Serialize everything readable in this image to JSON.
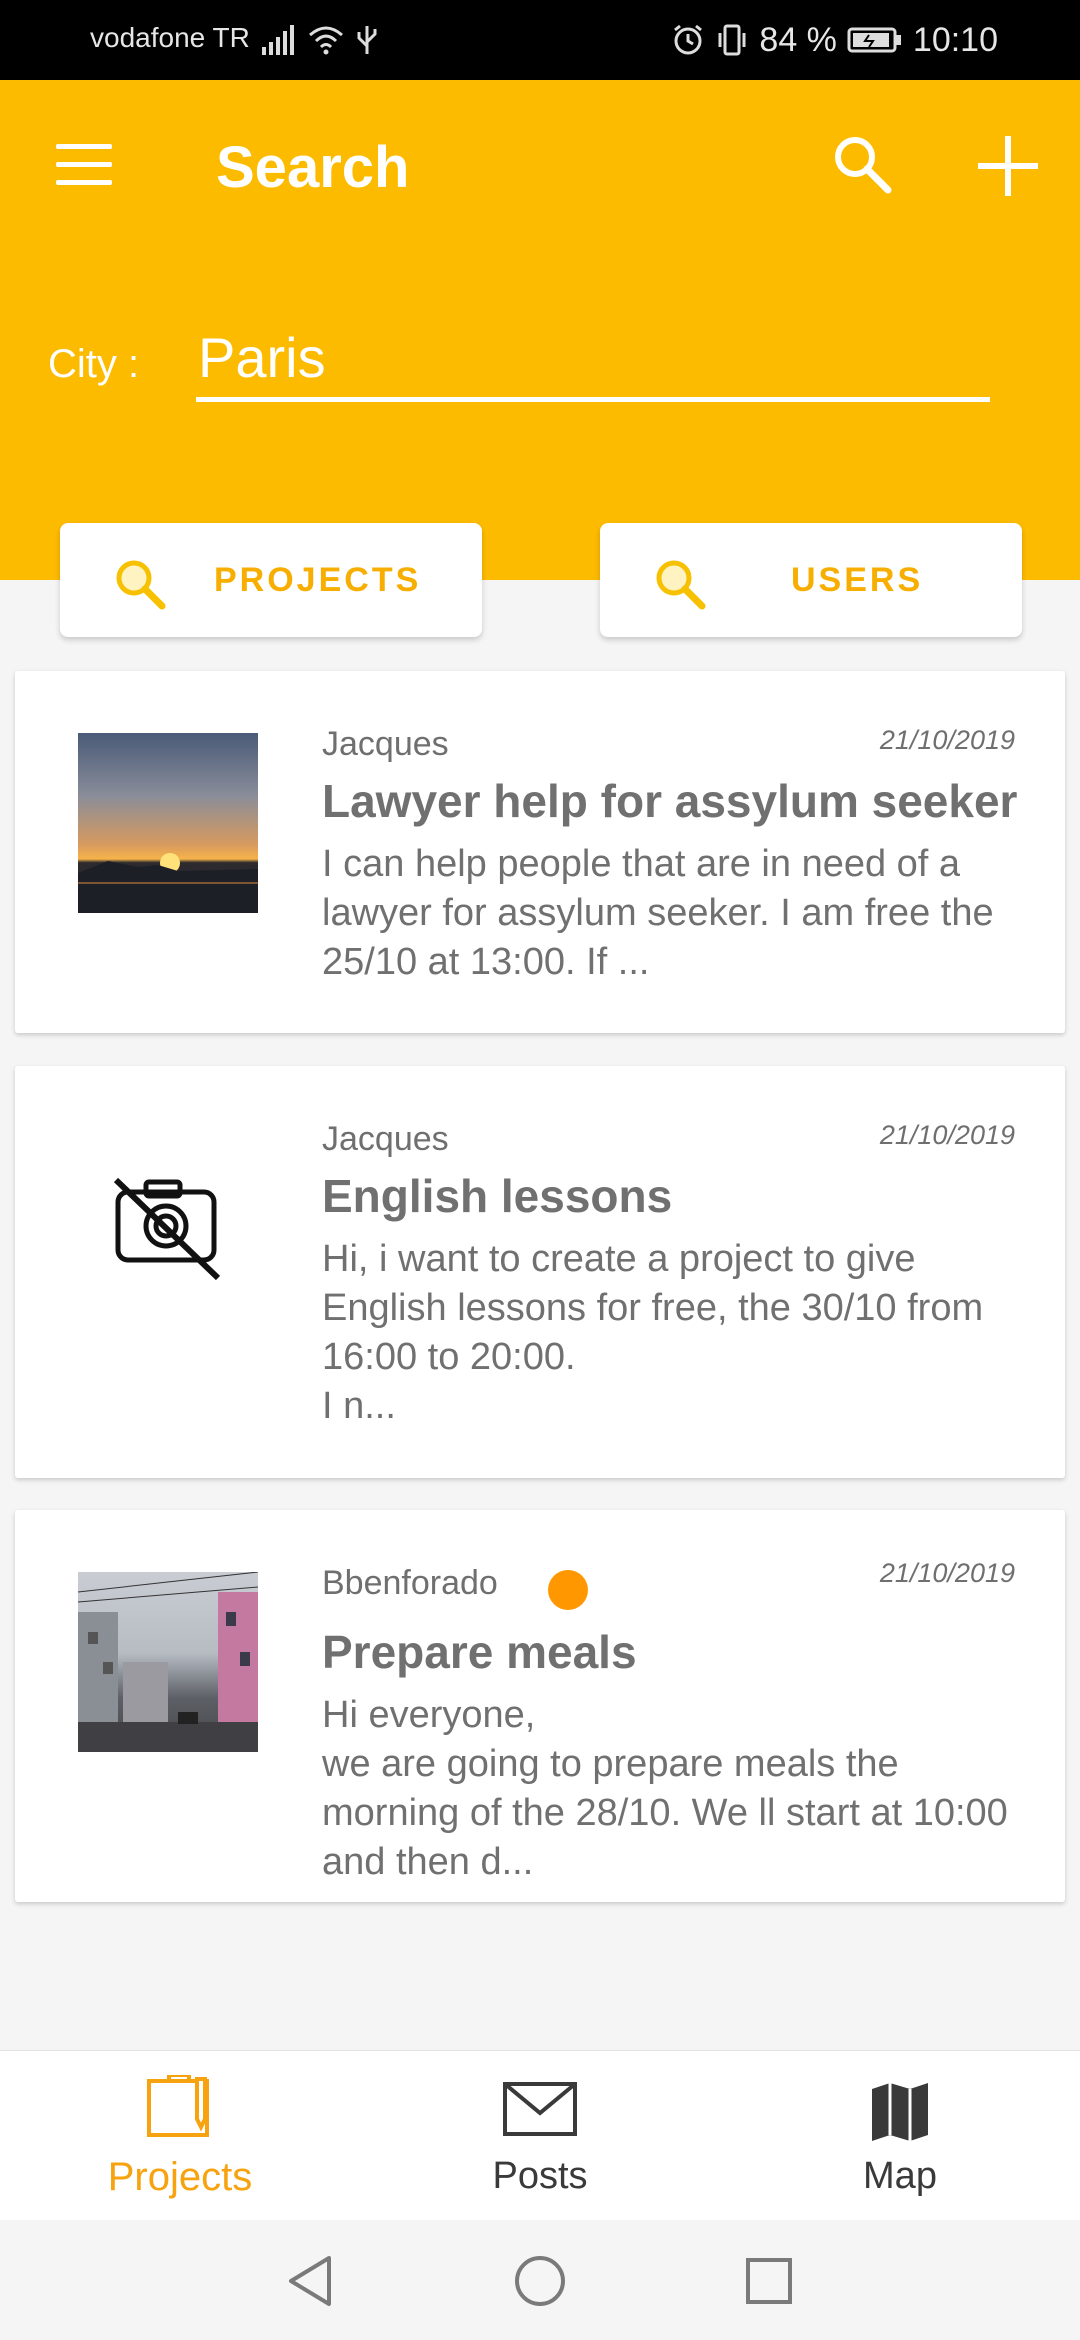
{
  "status_bar": {
    "carrier": "vodafone TR",
    "battery": "84 %",
    "time": "10:10"
  },
  "app_bar": {
    "title": "Search",
    "icons": [
      "menu-icon",
      "search-icon",
      "add-icon"
    ]
  },
  "search": {
    "city_label": "City :",
    "city_value": "Paris"
  },
  "filter_buttons": {
    "projects": "PROJECTS",
    "users": "USERS"
  },
  "projects": [
    {
      "author": "Jacques",
      "date": "21/10/2019",
      "title": "Lawyer help for assylum seeker",
      "description": "I can help people that are in need of a lawyer for assylum seeker. I am free the 25/10 at 13:00. If ...",
      "image": "sunset-photo"
    },
    {
      "author": "Jacques",
      "date": "21/10/2019",
      "title": "English lessons",
      "description": "Hi, i want to create a project to give English lessons for free, the 30/10 from 16:00 to 20:00.\nI n...",
      "image": "no-photo-icon"
    },
    {
      "author": "Bbenforado",
      "date": "21/10/2019",
      "title": "Prepare meals",
      "description": "Hi everyone,\nwe are going to prepare meals the morning of the 28/10. We ll start at 10:00 and then d...",
      "image": "street-photo"
    }
  ],
  "bottom_nav": {
    "items": [
      {
        "label": "Projects",
        "icon": "projects-icon",
        "active": true
      },
      {
        "label": "Posts",
        "icon": "mail-icon",
        "active": false
      },
      {
        "label": "Map",
        "icon": "map-icon",
        "active": false
      }
    ]
  },
  "colors": {
    "primary": "#fdbb00",
    "accent": "#f7a20f",
    "status_dot": "#ff9800"
  }
}
